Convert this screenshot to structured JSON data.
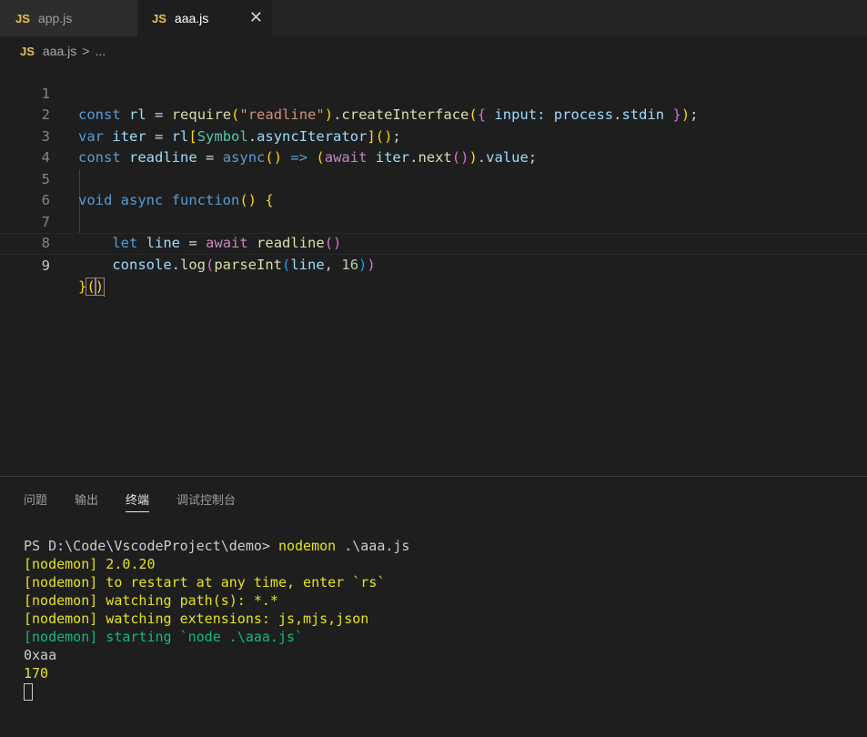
{
  "tabs": [
    {
      "icon": "JS",
      "label": "app.js"
    },
    {
      "icon": "JS",
      "label": "aaa.js",
      "close": "✕"
    }
  ],
  "breadcrumb": {
    "icon": "JS",
    "file": "aaa.js",
    "sep": ">",
    "rest": "..."
  },
  "line_numbers": [
    "1",
    "2",
    "3",
    "4",
    "5",
    "6",
    "7",
    "8",
    "9"
  ],
  "panel": {
    "tabs": [
      "问题",
      "输出",
      "终端",
      "调试控制台"
    ],
    "active_tab": "终端"
  },
  "terminal": {
    "prompt": "PS D:\\Code\\VscodeProject\\demo> ",
    "command": "nodemon",
    "command_arg": " .\\aaa.js",
    "lines": [
      "[nodemon] 2.0.20",
      "[nodemon] to restart at any time, enter `rs`",
      "[nodemon] watching path(s): *.*",
      "[nodemon] watching extensions: js,mjs,json"
    ],
    "starting": "[nodemon] starting `node .\\aaa.js`",
    "output": [
      "0xaa",
      "170"
    ]
  },
  "colors": {
    "background": "#1e1e1e",
    "tab_inactive": "#2d2d2d",
    "js_icon": "#e8c14b",
    "keyword": "#569cd6",
    "variable": "#9cdcfe",
    "function": "#dcdcaa",
    "string": "#ce9178",
    "number": "#b5cea8",
    "class": "#4ec9b0",
    "control": "#c586c0",
    "terminal_yellow": "#e5e510",
    "terminal_green": "#23d18b"
  }
}
